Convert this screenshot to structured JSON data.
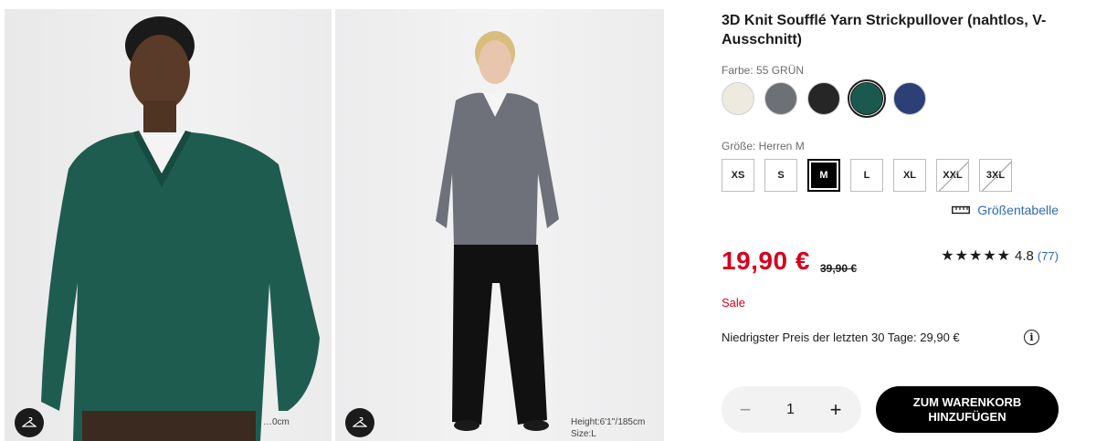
{
  "gallery": {
    "photo1": {
      "model_size": "…0cm"
    },
    "photo2": {
      "model_height": "Height:6'1''/185cm",
      "model_size": "Size:L"
    }
  },
  "product": {
    "title": "3D Knit Soufflé Yarn Strickpullover (nahtlos, V-Ausschnitt)",
    "color_label": "Farbe: 55 GRÜN",
    "colors": [
      {
        "name": "white",
        "hex": "#eeeae0"
      },
      {
        "name": "gray",
        "hex": "#6d7076"
      },
      {
        "name": "black",
        "hex": "#262626"
      },
      {
        "name": "green",
        "hex": "#1a5a4e",
        "selected": true
      },
      {
        "name": "navy",
        "hex": "#2c3f76"
      }
    ],
    "size_label": "Größe: Herren M",
    "sizes": [
      {
        "label": "XS",
        "state": "available"
      },
      {
        "label": "S",
        "state": "available"
      },
      {
        "label": "M",
        "state": "selected"
      },
      {
        "label": "L",
        "state": "available"
      },
      {
        "label": "XL",
        "state": "available"
      },
      {
        "label": "XXL",
        "state": "unavailable"
      },
      {
        "label": "3XL",
        "state": "unavailable"
      }
    ],
    "size_chart_link": "Größentabelle",
    "price": "19,90 €",
    "old_price": "39,90 €",
    "rating_stars": "★★★★★",
    "rating_value": "4.8",
    "rating_count": "(77)",
    "sale_label": "Sale",
    "lowest_price_text": "Niedrigster Preis der letzten 30 Tage: 29,90 €",
    "quantity": "1",
    "add_to_cart": "ZUM WARENKORB HINZUFÜGEN"
  },
  "colors": {
    "price_red": "#d6001c",
    "link_blue": "#2d6bb5"
  }
}
